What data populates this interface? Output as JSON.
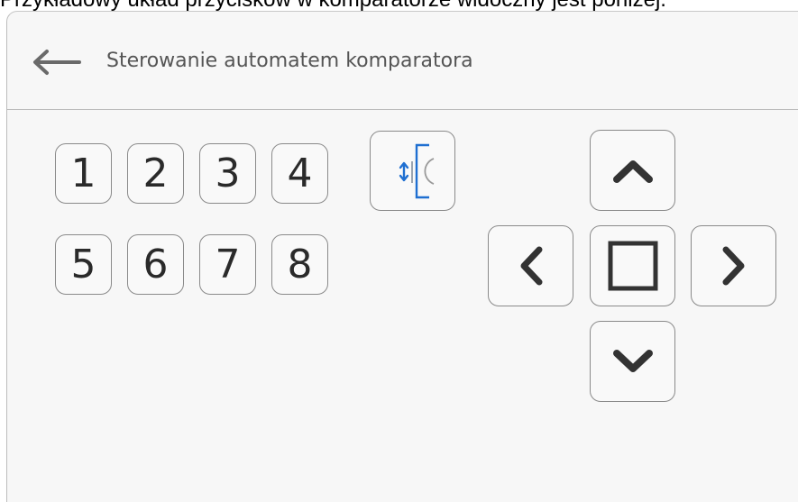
{
  "caption": "Przykładowy układ przycisków w komparatorze widoczny jest poniżej.",
  "header": {
    "title": "Sterowanie automatem komparatora",
    "back_icon": "arrow-left-icon"
  },
  "position_keys": [
    "1",
    "2",
    "3",
    "4",
    "5",
    "6",
    "7",
    "8"
  ],
  "calibration_key": {
    "icon": "load-position-icon"
  },
  "direction_pad": {
    "up_icon": "chevron-up-icon",
    "down_icon": "chevron-down-icon",
    "left_icon": "chevron-left-icon",
    "right_icon": "chevron-right-icon",
    "center_icon": "square-stop-icon"
  },
  "colors": {
    "panel_bg": "#f7f7f7",
    "text": "#555555",
    "icon_dark": "#333333",
    "accent_blue": "#1f6fd1"
  }
}
